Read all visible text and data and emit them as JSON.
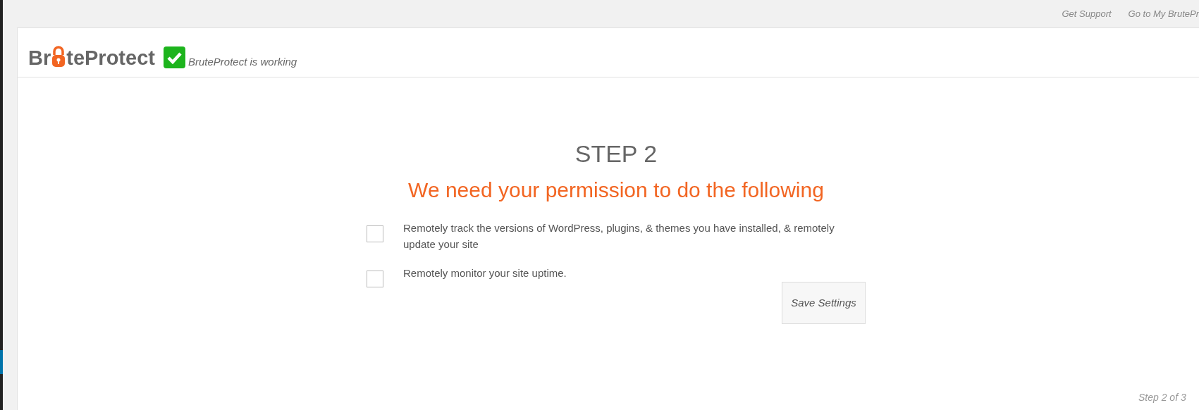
{
  "top_links": [
    "Get Support",
    "Go to My BrutePr"
  ],
  "logo": {
    "before": "Br",
    "after": "teProtect"
  },
  "status": {
    "text": "BruteProtect is working",
    "ok": true
  },
  "step_title": "STEP 2",
  "heading": "We need your permission to do the following",
  "permissions": [
    {
      "label": "Remotely track the versions of WordPress, plugins, & themes you have installed, & remotely update your site",
      "checked": false
    },
    {
      "label": "Remotely monitor your site uptime.",
      "checked": false
    }
  ],
  "save_button": "Save Settings",
  "footer": "Step 2 of 3"
}
